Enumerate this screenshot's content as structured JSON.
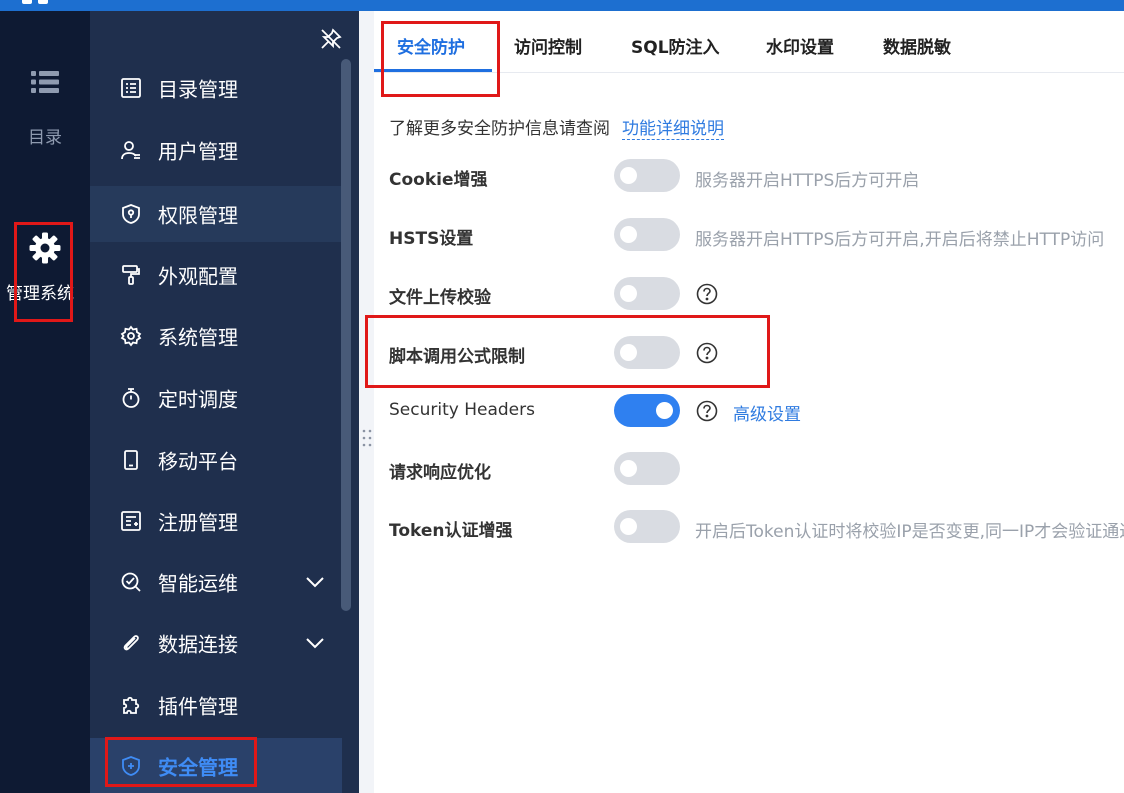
{
  "rail": {
    "items": [
      {
        "id": "catalog",
        "label": "目录",
        "icon": "list-icon"
      },
      {
        "id": "admin",
        "label": "管理系统",
        "icon": "gear-icon"
      }
    ]
  },
  "menu": {
    "items": [
      {
        "label": "目录管理",
        "icon": "catalog-list-icon"
      },
      {
        "label": "用户管理",
        "icon": "user-icon"
      },
      {
        "label": "权限管理",
        "icon": "permission-shield-icon"
      },
      {
        "label": "外观配置",
        "icon": "paint-roller-icon"
      },
      {
        "label": "系统管理",
        "icon": "settings-gear-icon"
      },
      {
        "label": "定时调度",
        "icon": "stopwatch-icon"
      },
      {
        "label": "移动平台",
        "icon": "mobile-icon"
      },
      {
        "label": "注册管理",
        "icon": "register-doc-icon"
      },
      {
        "label": "智能运维",
        "icon": "ai-ops-icon"
      },
      {
        "label": "数据连接",
        "icon": "paperclip-icon"
      },
      {
        "label": "插件管理",
        "icon": "puzzle-icon"
      },
      {
        "label": "安全管理",
        "icon": "security-shield-icon"
      }
    ],
    "active": "安全管理"
  },
  "tabs": [
    {
      "label": "安全防护",
      "active": true
    },
    {
      "label": "访问控制"
    },
    {
      "label": "SQL防注入"
    },
    {
      "label": "水印设置"
    },
    {
      "label": "数据脱敏"
    }
  ],
  "info": {
    "text": "了解更多安全防护信息请查阅",
    "link": "功能详细说明"
  },
  "settings": [
    {
      "label": "Cookie增强",
      "enabled": false,
      "hint": "服务器开启HTTPS后方可开启"
    },
    {
      "label": "HSTS设置",
      "enabled": false,
      "hint": "服务器开启HTTPS后方可开启,开启后将禁止HTTP访问"
    },
    {
      "label": "文件上传校验",
      "enabled": false
    },
    {
      "label": "脚本调用公式限制",
      "enabled": false
    },
    {
      "label": "Security Headers",
      "enabled": true,
      "link": "高级设置"
    },
    {
      "label": "请求响应优化",
      "enabled": false
    },
    {
      "label": "Token认证增强",
      "enabled": false,
      "hint": "开启后Token认证时将校验IP是否变更,同一IP才会验证通过"
    }
  ],
  "colors": {
    "primary": "#1f6fe0",
    "rail_bg": "#0e1a33",
    "menu_bg": "#1f2f4d",
    "toggle_on": "#2f80f0",
    "toggle_off": "#d9dce2",
    "highlight_box": "#e01818"
  }
}
